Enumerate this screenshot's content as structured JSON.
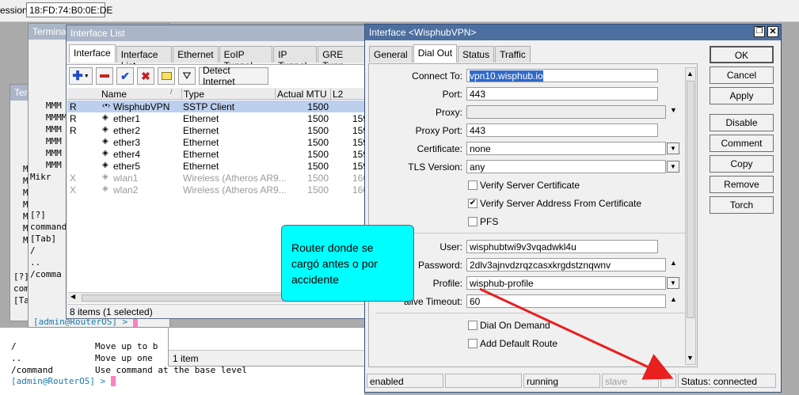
{
  "session": {
    "label": "ession:",
    "value": "18:FD:74:B0:0E:DE"
  },
  "terminals": {
    "back_title": "Terminal",
    "mid_title": "Term",
    "mid_lines": [
      "   MMM",
      "   MMMM",
      "   MMM",
      "   MMM",
      "   MMM",
      "   MMM",
      "",
      "Mikr"
    ],
    "mid_lines2": [
      "[?]",
      "command",
      "",
      "[Tab]",
      "",
      "/",
      "..",
      "/comma"
    ],
    "mid_prompt": "[admin@RouterOS] > ",
    "left_lines": [
      "M",
      "M",
      "M",
      "M",
      "M",
      "M",
      "",
      "M"
    ],
    "left_lines2": [
      "[?]",
      "com",
      "",
      "[Ta"
    ],
    "bottom_lines": [
      "/               Move up to b",
      "..              Move up one",
      "/command        Use command at the base level"
    ],
    "bottom_prompt": "[admin@RouterOS] > "
  },
  "interface_list": {
    "title": "Interface List",
    "tabs": [
      "Interface",
      "Interface List",
      "Ethernet",
      "EoIP Tunnel",
      "IP Tunnel",
      "GRE Tunn"
    ],
    "detect_label": "Detect Internet",
    "columns": [
      "Name",
      "Type",
      "Actual MTU",
      "L2 MTU"
    ],
    "rows": [
      {
        "flag": "R",
        "name": "WisphubVPN",
        "type": "SSTP Client",
        "mtu": "1500",
        "l2": "",
        "selected": true,
        "disabled": false
      },
      {
        "flag": "R",
        "name": "ether1",
        "type": "Ethernet",
        "mtu": "1500",
        "l2": "159",
        "selected": false,
        "disabled": false
      },
      {
        "flag": "R",
        "name": "ether2",
        "type": "Ethernet",
        "mtu": "1500",
        "l2": "159",
        "selected": false,
        "disabled": false
      },
      {
        "flag": "",
        "name": "ether3",
        "type": "Ethernet",
        "mtu": "1500",
        "l2": "159",
        "selected": false,
        "disabled": false
      },
      {
        "flag": "",
        "name": "ether4",
        "type": "Ethernet",
        "mtu": "1500",
        "l2": "159",
        "selected": false,
        "disabled": false
      },
      {
        "flag": "",
        "name": "ether5",
        "type": "Ethernet",
        "mtu": "1500",
        "l2": "159",
        "selected": false,
        "disabled": false
      },
      {
        "flag": "X",
        "name": "wlan1",
        "type": "Wireless (Atheros AR9...",
        "mtu": "1500",
        "l2": "160",
        "selected": false,
        "disabled": true
      },
      {
        "flag": "X",
        "name": "wlan2",
        "type": "Wireless (Atheros AR9...",
        "mtu": "1500",
        "l2": "160",
        "selected": false,
        "disabled": true
      }
    ],
    "count": "8 items (1 selected)",
    "lower_count": "1 item"
  },
  "dialog": {
    "title": "Interface <WisphubVPN>",
    "tabs": [
      "General",
      "Dial Out",
      "Status",
      "Traffic"
    ],
    "fields": {
      "connect_to": {
        "label": "Connect To:",
        "value": "vpn10.wisphub.io"
      },
      "port": {
        "label": "Port:",
        "value": "443"
      },
      "proxy": {
        "label": "Proxy:",
        "value": ""
      },
      "proxy_port": {
        "label": "Proxy Port:",
        "value": "443"
      },
      "certificate": {
        "label": "Certificate:",
        "value": "none"
      },
      "tls_version": {
        "label": "TLS Version:",
        "value": "any"
      },
      "user": {
        "label": "User:",
        "value": "wisphubtwi9v3vqadwkl4u"
      },
      "password": {
        "label": "Password:",
        "value": "2dlv3ajnvdzrqzcasxkrgdstznqwnv"
      },
      "profile": {
        "label": "Profile:",
        "value": "wisphub-profile"
      },
      "keepalive": {
        "label": "alive Timeout:",
        "value": "60"
      }
    },
    "checks": {
      "verify_cert": {
        "label": "Verify Server Certificate",
        "checked": false
      },
      "verify_addr": {
        "label": "Verify Server Address From Certificate",
        "checked": true
      },
      "pfs": {
        "label": "PFS",
        "checked": false
      },
      "dial_on_demand": {
        "label": "Dial On Demand",
        "checked": false
      },
      "add_default_route": {
        "label": "Add Default Route",
        "checked": false
      }
    },
    "buttons": [
      "OK",
      "Cancel",
      "Apply",
      "Disable",
      "Comment",
      "Copy",
      "Remove",
      "Torch"
    ],
    "status": {
      "enabled": "enabled",
      "running": "running",
      "slave": "slave",
      "state": "Status: connected"
    }
  },
  "callout": {
    "text": "Router donde se cargó antes o por accidente",
    "bg": "#00ffff"
  },
  "colors": {
    "accent": "#4c6f9f",
    "selection": "#bcd0ee",
    "arrow": "#ff0000"
  }
}
